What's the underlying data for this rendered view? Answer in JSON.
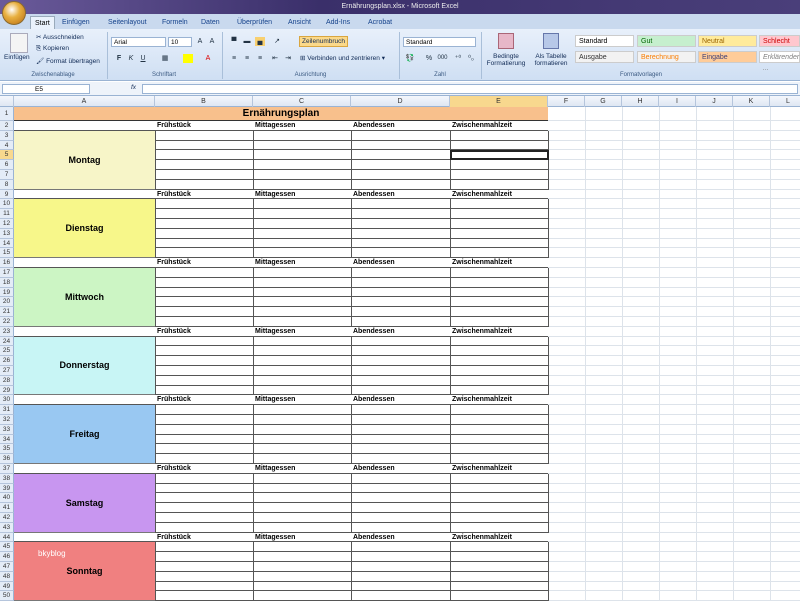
{
  "window": {
    "title": "Ernährungsplan.xlsx - Microsoft Excel"
  },
  "tabs": [
    "Start",
    "Einfügen",
    "Seitenlayout",
    "Formeln",
    "Daten",
    "Überprüfen",
    "Ansicht",
    "Add-Ins",
    "Acrobat"
  ],
  "active_tab": "Start",
  "ribbon": {
    "clipboard": {
      "paste": "Einfügen",
      "cut": "Ausschneiden",
      "copy": "Kopieren",
      "format_painter": "Format übertragen",
      "label": "Zwischenablage"
    },
    "font": {
      "name": "Arial",
      "size": "10",
      "bold": "F",
      "italic": "K",
      "underline": "U",
      "label": "Schriftart"
    },
    "alignment": {
      "wrap": "Zeilenumbruch",
      "merge": "Verbinden und zentrieren",
      "label": "Ausrichtung"
    },
    "number": {
      "format": "Standard",
      "percent": "%",
      "thousands": "000",
      "label": "Zahl"
    },
    "styles": {
      "conditional": "Bedingte Formatierung",
      "as_table": "Als Tabelle formatieren",
      "label": "Formatvorlagen",
      "items": [
        {
          "label": "Standard",
          "bg": "#ffffff"
        },
        {
          "label": "Gut",
          "bg": "#c6efce"
        },
        {
          "label": "Neutral",
          "bg": "#ffeb9c"
        },
        {
          "label": "Schlecht",
          "bg": "#ffc7ce"
        },
        {
          "label": "Ausgabe",
          "bg": "#f2f2f2"
        },
        {
          "label": "Berechnung",
          "bg": "#f2f2f2"
        },
        {
          "label": "Eingabe",
          "bg": "#ffcc99"
        },
        {
          "label": "Erklärender ...",
          "bg": "#ffffff"
        }
      ]
    }
  },
  "formula_bar": {
    "name_box": "E5",
    "fx": "fx",
    "value": ""
  },
  "columns": [
    "A",
    "B",
    "C",
    "D",
    "E",
    "F",
    "G",
    "H",
    "I",
    "J",
    "K",
    "L"
  ],
  "selected_cell": "E5",
  "sheet": {
    "title": "Ernährungsplan",
    "title_color": "#f8c08c",
    "meal_headers": [
      "Frühstück",
      "Mittagessen",
      "Abendessen",
      "Zwischenmahlzeit"
    ],
    "days": [
      {
        "name": "Montag",
        "color": "#f7f5c8"
      },
      {
        "name": "Dienstag",
        "color": "#f7f78a"
      },
      {
        "name": "Mittwoch",
        "color": "#ccf5c4"
      },
      {
        "name": "Donnerstag",
        "color": "#c8f5f5"
      },
      {
        "name": "Freitag",
        "color": "#99c8f2"
      },
      {
        "name": "Samstag",
        "color": "#c896f0"
      },
      {
        "name": "Sonntag",
        "color": "#f08080"
      }
    ],
    "watermark": "bkyblog"
  }
}
